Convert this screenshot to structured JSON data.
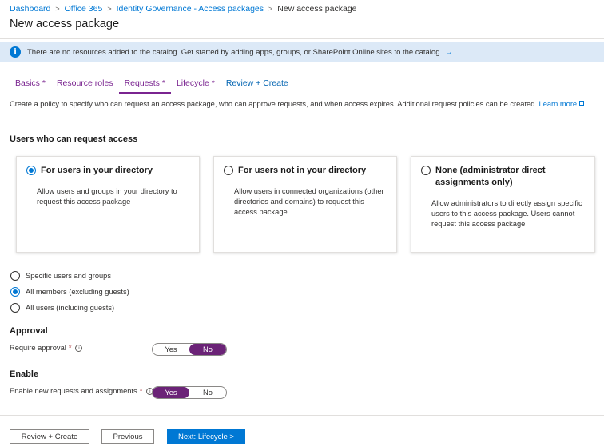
{
  "breadcrumb": {
    "items": [
      "Dashboard",
      "Office 365",
      "Identity Governance - Access packages"
    ],
    "current": "New access package",
    "separator": ">"
  },
  "page": {
    "title": "New access package"
  },
  "banner": {
    "icon": "info-icon",
    "text": "There are no resources added to the catalog. Get started by adding apps, groups, or SharePoint Online sites to the catalog.",
    "arrow": "→"
  },
  "tabs": [
    {
      "label": "Basics",
      "required": "*"
    },
    {
      "label": "Resource roles",
      "required": ""
    },
    {
      "label": "Requests",
      "required": "*"
    },
    {
      "label": "Lifecycle",
      "required": "*"
    },
    {
      "label": "Review + Create",
      "required": ""
    }
  ],
  "description": {
    "text": "Create a policy to specify who can request an access package, who can approve requests, and when access expires. Additional request policies can be created.",
    "link": "Learn more"
  },
  "users_section": {
    "heading": "Users who can request access",
    "cards": [
      {
        "title": "For users in your directory",
        "description": "Allow users and groups in your directory to request this access package",
        "selected": true
      },
      {
        "title": "For users not in your directory",
        "description": "Allow users in connected organizations (other directories and domains) to request this access package",
        "selected": false
      },
      {
        "title": "None (administrator direct assignments only)",
        "description": "Allow administrators to directly assign specific users to this access package. Users cannot request this access package",
        "selected": false
      }
    ],
    "options": [
      {
        "label": "Specific users and groups",
        "selected": false
      },
      {
        "label": "All members (excluding guests)",
        "selected": true
      },
      {
        "label": "All users (including guests)",
        "selected": false
      }
    ]
  },
  "approval": {
    "heading": "Approval",
    "label": "Require approval",
    "required": "*",
    "yes": "Yes",
    "no": "No",
    "value": "No"
  },
  "enable": {
    "heading": "Enable",
    "label": "Enable new requests and assignments",
    "required": "*",
    "yes": "Yes",
    "no": "No",
    "value": "Yes"
  },
  "footer": {
    "review_create": "Review + Create",
    "previous": "Previous",
    "next": "Next: Lifecycle >"
  },
  "colors": {
    "accent_blue": "#0078d4",
    "tab_purple": "#7a2490",
    "toggle_purple": "#6b2377",
    "banner_bg": "#dce9f7"
  }
}
